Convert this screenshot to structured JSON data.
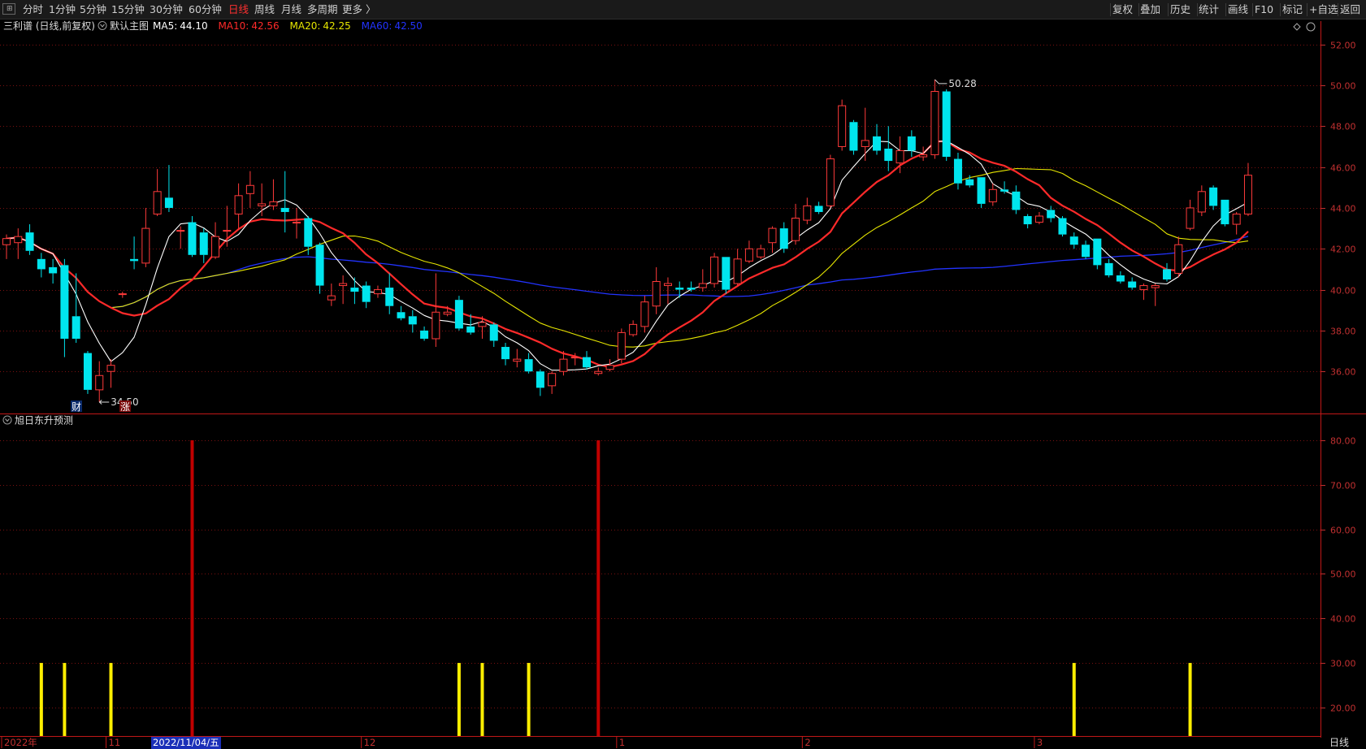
{
  "toolbar": {
    "periods": [
      "分时",
      "1分钟",
      "5分钟",
      "15分钟",
      "30分钟",
      "60分钟",
      "日线",
      "周线",
      "月线",
      "多周期",
      "更多 〉"
    ],
    "active_period": "日线",
    "right_buttons": [
      "复权",
      "叠加",
      "历史",
      "统计",
      "画线",
      "F10",
      "标记",
      "+自选",
      "返回"
    ]
  },
  "main_panel": {
    "stock": "三利谱 (日线,前复权)",
    "template": "默认主图",
    "ma": [
      {
        "label": "MA5:",
        "value": "44.10",
        "color": "#ffffff"
      },
      {
        "label": "MA10:",
        "value": "42.56",
        "color": "#ff2a2a"
      },
      {
        "label": "MA20:",
        "value": "42.25",
        "color": "#e6e600"
      },
      {
        "label": "MA60:",
        "value": "42.50",
        "color": "#2233ff"
      }
    ],
    "high_label": "50.28",
    "low_label": "34.50",
    "badge_cai": "财",
    "badge_zhang": "涨"
  },
  "sub_panel": {
    "title": "旭日东升预测"
  },
  "bottom": {
    "year_label": "2022年",
    "cursor_date": "2022/11/04/五",
    "period_label": "日线"
  },
  "colors": {
    "up": "#ff3a3a",
    "down": "#00e5ee",
    "grid": "#7a1010",
    "axis": "#c03030",
    "signal_red": "#c00000",
    "signal_yellow": "#ffee00"
  },
  "chart_data": {
    "type": "candlestick",
    "price_axis": {
      "ticks": [
        36,
        38,
        40,
        42,
        44,
        46,
        48,
        50,
        52
      ],
      "ylim": [
        34.3,
        52.9
      ]
    },
    "indicator_axis": {
      "ticks": [
        20,
        30,
        40,
        50,
        60,
        70,
        80
      ],
      "ylim": [
        13.6,
        84
      ]
    },
    "x_axis_labels": [
      {
        "label": "2022年",
        "index": 0
      },
      {
        "label": "11",
        "index": 9
      },
      {
        "label": "12",
        "index": 31
      },
      {
        "label": "1",
        "index": 53
      },
      {
        "label": "2",
        "index": 69
      },
      {
        "label": "3",
        "index": 89
      }
    ],
    "candles": [
      [
        42.2,
        42.5,
        41.5,
        42.7
      ],
      [
        42.3,
        42.6,
        41.5,
        43
      ],
      [
        42.8,
        41.9,
        41.7,
        43.2
      ],
      [
        41.5,
        41.0,
        40.6,
        41.8
      ],
      [
        41.1,
        40.8,
        40.3,
        41.5
      ],
      [
        41.2,
        37.6,
        36.7,
        41.5
      ],
      [
        38.7,
        37.6,
        37.4,
        40.8
      ],
      [
        36.9,
        35.1,
        34.9,
        37
      ],
      [
        35.1,
        35.8,
        34.5,
        36.5
      ],
      [
        36.0,
        36.3,
        35.2,
        36.6
      ],
      [
        39.8,
        39.8,
        39.6,
        39.9
      ],
      [
        41.5,
        41.4,
        41.0,
        42.6
      ],
      [
        41.3,
        43.0,
        41.1,
        44.0
      ],
      [
        43.7,
        44.8,
        43.6,
        45.9
      ],
      [
        44.5,
        44.0,
        43.8,
        46.1
      ],
      [
        42.9,
        42.9,
        42.0,
        43.1
      ],
      [
        43.3,
        41.7,
        41.6,
        43.6
      ],
      [
        42.8,
        41.7,
        41.3,
        43.0
      ],
      [
        41.6,
        42.6,
        41.5,
        43.3
      ],
      [
        42.9,
        42.9,
        42.1,
        44.1
      ],
      [
        43.7,
        44.6,
        43.0,
        45.2
      ],
      [
        44.7,
        45.1,
        44.0,
        45.8
      ],
      [
        44.1,
        44.2,
        43.6,
        45.2
      ],
      [
        44.1,
        44.3,
        43.9,
        45.4
      ],
      [
        44.0,
        43.8,
        42.8,
        45.8
      ],
      [
        43.3,
        43.3,
        42.5,
        44.0
      ],
      [
        43.5,
        42.1,
        41.7,
        43.6
      ],
      [
        42.2,
        40.2,
        39.8,
        42.3
      ],
      [
        39.5,
        39.7,
        39.2,
        40.3
      ],
      [
        40.2,
        40.3,
        39.3,
        40.7
      ],
      [
        40.1,
        39.9,
        39.3,
        40.6
      ],
      [
        40.2,
        39.4,
        39.1,
        40.4
      ],
      [
        39.8,
        40.0,
        39.6,
        40.2
      ],
      [
        40.1,
        39.2,
        38.8,
        40.8
      ],
      [
        38.9,
        38.6,
        38.5,
        39.2
      ],
      [
        38.7,
        38.3,
        37.9,
        39.0
      ],
      [
        38.0,
        37.6,
        37.5,
        38.2
      ],
      [
        37.6,
        38.9,
        37.2,
        40.8
      ],
      [
        38.8,
        38.9,
        38.7,
        39.2
      ],
      [
        39.5,
        38.1,
        38.0,
        39.7
      ],
      [
        38.2,
        37.9,
        37.8,
        38.8
      ],
      [
        38.2,
        38.4,
        37.6,
        38.7
      ],
      [
        38.3,
        37.5,
        37.2,
        38.4
      ],
      [
        37.2,
        36.6,
        36.3,
        37.4
      ],
      [
        36.5,
        36.6,
        36.2,
        37.1
      ],
      [
        36.6,
        36.0,
        35.9,
        36.9
      ],
      [
        36.0,
        35.2,
        34.8,
        36.1
      ],
      [
        35.3,
        35.9,
        34.9,
        36.0
      ],
      [
        36.0,
        36.6,
        35.8,
        37.0
      ],
      [
        36.7,
        36.7,
        36.3,
        36.9
      ],
      [
        36.7,
        36.2,
        36.1,
        37.0
      ],
      [
        35.9,
        36.0,
        35.8,
        36.2
      ],
      [
        36.1,
        36.3,
        36.0,
        36.6
      ],
      [
        36.6,
        37.9,
        36.4,
        38.1
      ],
      [
        37.8,
        38.3,
        37.7,
        38.5
      ],
      [
        38.2,
        39.4,
        37.9,
        39.7
      ],
      [
        39.2,
        40.4,
        38.8,
        41.1
      ],
      [
        40.2,
        40.3,
        39.3,
        40.6
      ],
      [
        40.1,
        40.0,
        39.6,
        40.4
      ],
      [
        40.1,
        40.0,
        39.9,
        40.4
      ],
      [
        40.1,
        40.3,
        39.9,
        41.0
      ],
      [
        40.3,
        41.6,
        40.1,
        41.8
      ],
      [
        41.6,
        40.0,
        39.8,
        41.6
      ],
      [
        40.3,
        41.5,
        40.2,
        42.0
      ],
      [
        41.4,
        42.0,
        41.3,
        42.4
      ],
      [
        41.6,
        42.0,
        41.5,
        42.2
      ],
      [
        42.3,
        43.0,
        41.8,
        43.1
      ],
      [
        43.0,
        42.0,
        41.8,
        43.3
      ],
      [
        42.4,
        43.5,
        42.2,
        44.2
      ],
      [
        43.4,
        44.1,
        43.2,
        44.5
      ],
      [
        44.1,
        43.8,
        43.7,
        44.3
      ],
      [
        44.1,
        46.4,
        44.0,
        46.6
      ],
      [
        47.0,
        49.0,
        46.8,
        49.3
      ],
      [
        48.2,
        46.8,
        46.6,
        48.3
      ],
      [
        47.0,
        47.3,
        46.3,
        48.9
      ],
      [
        47.5,
        46.8,
        46.6,
        48.1
      ],
      [
        46.9,
        46.3,
        45.8,
        48.0
      ],
      [
        46.2,
        46.8,
        45.7,
        47.5
      ],
      [
        47.5,
        46.8,
        46.5,
        47.8
      ],
      [
        46.5,
        46.6,
        46.3,
        47.0
      ],
      [
        46.6,
        49.7,
        46.4,
        50.28
      ],
      [
        49.7,
        46.5,
        46.3,
        49.8
      ],
      [
        46.4,
        45.2,
        44.9,
        46.7
      ],
      [
        45.4,
        45.1,
        45.0,
        45.6
      ],
      [
        45.5,
        44.2,
        44.0,
        45.5
      ],
      [
        44.3,
        44.9,
        44.1,
        45.2
      ],
      [
        44.9,
        44.8,
        44.7,
        45.3
      ],
      [
        44.8,
        43.9,
        43.7,
        45.1
      ],
      [
        43.6,
        43.2,
        43.0,
        43.7
      ],
      [
        43.3,
        43.6,
        43.2,
        43.8
      ],
      [
        43.9,
        43.5,
        43.3,
        44.1
      ],
      [
        43.5,
        42.7,
        42.6,
        43.6
      ],
      [
        42.6,
        42.2,
        42.0,
        42.8
      ],
      [
        42.2,
        41.6,
        41.5,
        42.4
      ],
      [
        42.5,
        41.2,
        41.0,
        42.5
      ],
      [
        41.3,
        40.7,
        40.6,
        41.5
      ],
      [
        40.7,
        40.4,
        40.3,
        40.9
      ],
      [
        40.4,
        40.1,
        40.0,
        40.6
      ],
      [
        40.0,
        40.2,
        39.5,
        40.3
      ],
      [
        40.1,
        40.2,
        39.2,
        40.3
      ],
      [
        41.0,
        40.5,
        40.4,
        41.3
      ],
      [
        40.8,
        42.2,
        40.6,
        42.6
      ],
      [
        43.0,
        44.0,
        42.9,
        44.4
      ],
      [
        43.8,
        44.8,
        43.6,
        45.1
      ],
      [
        45.0,
        44.1,
        43.9,
        45.1
      ],
      [
        44.4,
        43.2,
        43.1,
        44.4
      ],
      [
        43.2,
        43.7,
        42.7,
        43.8
      ],
      [
        43.7,
        45.6,
        43.6,
        46.2
      ]
    ],
    "signals": [
      {
        "index": 3,
        "value": 30,
        "color": "yellow"
      },
      {
        "index": 5,
        "value": 30,
        "color": "yellow"
      },
      {
        "index": 9,
        "value": 30,
        "color": "yellow"
      },
      {
        "index": 16,
        "value": 80,
        "color": "red"
      },
      {
        "index": 39,
        "value": 30,
        "color": "yellow"
      },
      {
        "index": 41,
        "value": 30,
        "color": "yellow"
      },
      {
        "index": 45,
        "value": 30,
        "color": "yellow"
      },
      {
        "index": 51,
        "value": 80,
        "color": "red"
      },
      {
        "index": 92,
        "value": 30,
        "color": "yellow"
      },
      {
        "index": 102,
        "value": 30,
        "color": "yellow"
      }
    ]
  }
}
